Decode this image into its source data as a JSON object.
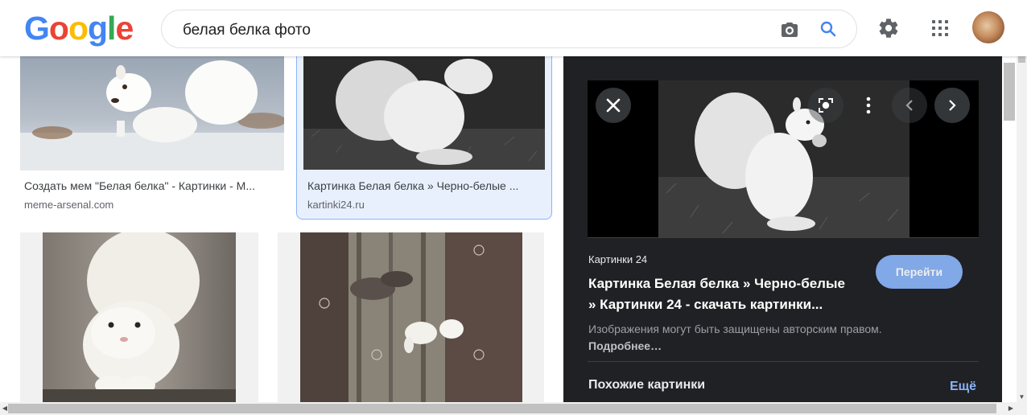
{
  "header": {
    "logo_letters": [
      {
        "ch": "G",
        "color": "#4285F4"
      },
      {
        "ch": "o",
        "color": "#EA4335"
      },
      {
        "ch": "o",
        "color": "#FBBC05"
      },
      {
        "ch": "g",
        "color": "#4285F4"
      },
      {
        "ch": "l",
        "color": "#34A853"
      },
      {
        "ch": "e",
        "color": "#EA4335"
      }
    ],
    "search_value": "белая белка фото",
    "icons": [
      "camera-icon",
      "search-icon",
      "gear-icon",
      "apps-icon",
      "avatar"
    ]
  },
  "results": [
    {
      "caption": "Создать мем \"Белая белка\" - Картинки - M...",
      "domain": "meme-arsenal.com"
    },
    {
      "caption": "Картинка Белая белка » Черно-белые ...",
      "domain": "kartinki24.ru",
      "selected": true
    },
    {
      "caption": "",
      "domain": ""
    },
    {
      "caption": "",
      "domain": ""
    }
  ],
  "panel": {
    "source": "Картинки 24",
    "title": "Картинка Белая белка » Черно-белые » Картинки 24 - скачать картинки...",
    "go_button": "Перейти",
    "copyright_text": "Изображения могут быть защищены авторским правом.",
    "copyright_link": "Подробнее…",
    "similar_heading": "Похожие картинки",
    "more_link": "Ещё",
    "icons": [
      "close-icon",
      "lens-icon",
      "more-vert-icon",
      "chevron-left-icon",
      "chevron-right-icon"
    ]
  },
  "colors": {
    "panel_bg": "#202124",
    "accent_blue": "#8ab4f8",
    "selected_bg": "#e8f0fe"
  }
}
